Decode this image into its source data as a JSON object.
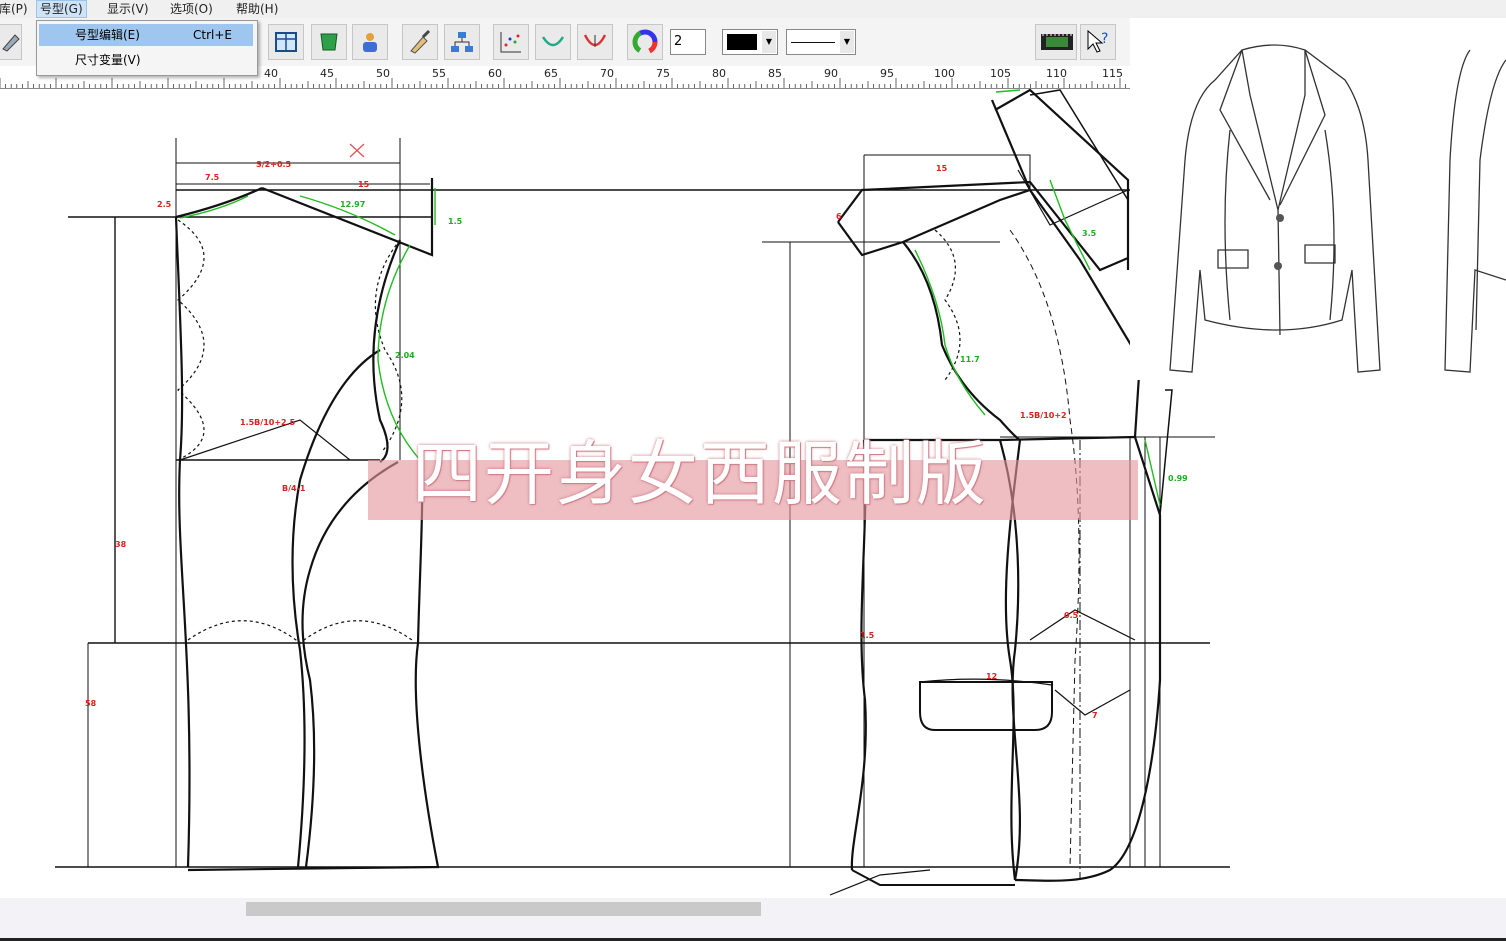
{
  "menubar": {
    "items": [
      {
        "label": "库(P)"
      },
      {
        "label": "号型(G)"
      },
      {
        "label": "显示(V)"
      },
      {
        "label": "选项(O)"
      },
      {
        "label": "帮助(H)"
      }
    ]
  },
  "dropdown": {
    "items": [
      {
        "label": "号型编辑(E)",
        "shortcut": "Ctrl+E"
      },
      {
        "label": "尺寸变量(V)",
        "shortcut": ""
      }
    ]
  },
  "toolbar": {
    "line_width_value": "2",
    "line_color": "#000000",
    "icons": [
      "eraser-icon",
      "grid-piece-icon",
      "shield-piece-icon",
      "people-icon",
      "brush-icon",
      "network-icon",
      "scatter-icon",
      "curve-icon",
      "measure-curve-icon",
      "color-wheel-icon",
      "film-icon",
      "help-cursor-icon"
    ]
  },
  "ruler": {
    "labels": [
      "40",
      "45",
      "50",
      "55",
      "60",
      "65",
      "70",
      "75",
      "80",
      "85",
      "90",
      "95",
      "100",
      "105",
      "110",
      "115"
    ]
  },
  "pattern": {
    "colors": {
      "line": "#111111",
      "measure": "#e02020",
      "guide": "#22bb22"
    },
    "labels": {
      "t1": "S/2+0.5",
      "t2": "7.5",
      "t3": "15",
      "t4": "2.5",
      "t5": "12.97",
      "t6": "1.5",
      "t7": "2.04",
      "t8": "1.5B/10+2.5",
      "t9": "B/4-1",
      "t10": "38",
      "t11": "58",
      "t12": "15",
      "t13": "6",
      "t14": "3.5",
      "t15": "11.7",
      "t16": "1.5B/10+2",
      "t17": "0.99",
      "t18": "12",
      "t19": "7",
      "t20": "0.5",
      "t21": "1.5"
    }
  },
  "banner": {
    "title": "四开身女西服制版"
  }
}
